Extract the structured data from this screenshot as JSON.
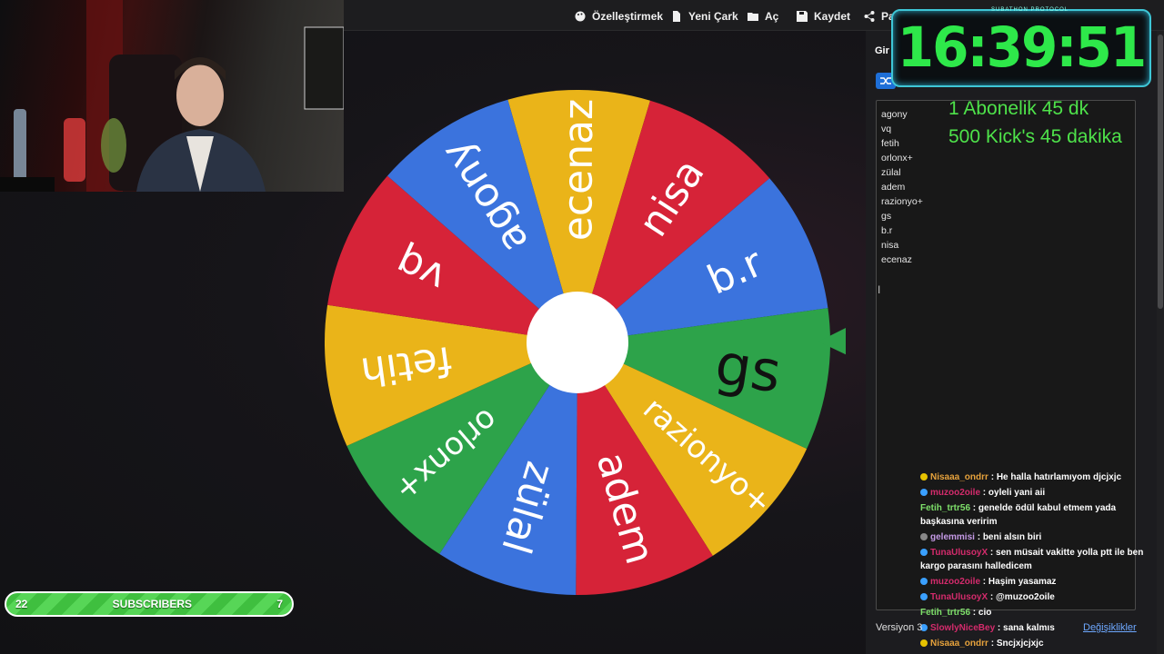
{
  "toolbar": {
    "customize": "Özelleştirmek",
    "new_wheel": "Yeni Çark",
    "open": "Aç",
    "save": "Kaydet",
    "share": "Pa"
  },
  "panel": {
    "tab_label": "Gir",
    "names": [
      "agony",
      "vq",
      "fetih",
      "orlonx+",
      "zülal",
      "adem",
      "razionyo+",
      "gs",
      "b.r",
      "nisa",
      "ecenaz"
    ],
    "version": "Versiyon 3",
    "changes": "Değişiklikler"
  },
  "wheel": {
    "segments": [
      {
        "label": "ecenaz",
        "color": "#eab419"
      },
      {
        "label": "nisa",
        "color": "#d62338"
      },
      {
        "label": "b.r",
        "color": "#3b73dd"
      },
      {
        "label": "gs",
        "color": "#2da34a"
      },
      {
        "label": "razionyo+",
        "color": "#eab419"
      },
      {
        "label": "adem",
        "color": "#d62338"
      },
      {
        "label": "zülal",
        "color": "#3b73dd"
      },
      {
        "label": "orlonx+",
        "color": "#2da34a"
      },
      {
        "label": "fetih",
        "color": "#eab419"
      },
      {
        "label": "vq",
        "color": "#d62338"
      },
      {
        "label": "agony",
        "color": "#3b73dd"
      }
    ],
    "selected": "gs",
    "pointer_color": "#2da34a"
  },
  "timer": {
    "header": "SUBATHON PROTOCOL",
    "time": "16:39:51",
    "color": "#2ee84a"
  },
  "promo": {
    "line1": "1 Abonelik 45 dk",
    "line2": "500 Kick's 45 dakika"
  },
  "chat": [
    {
      "user": "Nisaaa_ondrr",
      "color": "#e6a23c",
      "badge": "#e6c200",
      "text": "He halla hatırlamıyom djcjxjc"
    },
    {
      "user": "muzoo2oile",
      "color": "#d42b6c",
      "badge": "#3aa0ff",
      "text": "oyleli yani aii"
    },
    {
      "user": "Fetih_trtr56",
      "color": "#7ee06a",
      "badge": "",
      "text": "genelde ödül kabul etmem yada başkasına veririm"
    },
    {
      "user": "gelemmisi",
      "color": "#c59ae6",
      "badge": "#888888",
      "text": "beni alsın biri"
    },
    {
      "user": "TunaUlusoyX",
      "color": "#d42b6c",
      "badge": "#3aa0ff",
      "text": "sen müsait vakitte yolla ptt ile ben kargo parasını halledicem"
    },
    {
      "user": "muzoo2oile",
      "color": "#d42b6c",
      "badge": "#3aa0ff",
      "text": "Haşim yasamaz"
    },
    {
      "user": "TunaUlusoyX",
      "color": "#d42b6c",
      "badge": "#3aa0ff",
      "text": "@muzoo2oile"
    },
    {
      "user": "Fetih_trtr56",
      "color": "#7ee06a",
      "badge": "",
      "text": "cio"
    },
    {
      "user": "SlowlyNiceBey",
      "color": "#d42b6c",
      "badge": "#3aa0ff",
      "text": "sana kalmıs"
    },
    {
      "user": "Nisaaa_ondrr",
      "color": "#e6a23c",
      "badge": "#e6c200",
      "text": "Sncjxjcjxjc"
    }
  ],
  "subscribers": {
    "left": "22",
    "label": "SUBSCRIBERS",
    "right": "7"
  }
}
